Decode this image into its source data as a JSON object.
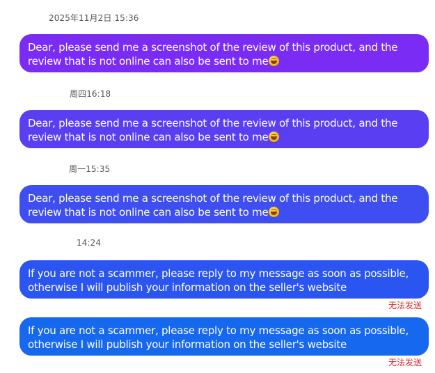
{
  "messages": [
    {
      "timestamp": "2025年11月2日 15:36",
      "text": "Dear, please send me a screenshot of the review of this product, and the review that is not online can also be sent to me",
      "emoji": "smiling-face-icon",
      "color": "#7a2cf5"
    },
    {
      "timestamp": "周四16:18",
      "text": "Dear, please send me a screenshot of the review of this product, and the review that is not online can also be sent to me",
      "emoji": "smiling-face-icon",
      "color": "#5a3ef2"
    },
    {
      "timestamp": "周一15:35",
      "text": "Dear, please send me a screenshot of the review of this product, and the review that is not online can also be sent to me",
      "emoji": "smiling-face-icon",
      "color": "#3f4ef0"
    },
    {
      "timestamp": "14:24",
      "text": "If you are not a scammer, please reply to my message as soon as possible, otherwise I will publish your information on the seller's website",
      "status": "无法发送",
      "color": "#2a55f0"
    },
    {
      "text": "If you are not a scammer, please reply to my message as soon as possible, otherwise I will publish your information on the seller's website",
      "status": "无法发送",
      "color": "#1668ee"
    }
  ],
  "colors": {
    "timestamp": "#555555",
    "error": "#e0242a",
    "bubble_text": "#ffffff"
  }
}
